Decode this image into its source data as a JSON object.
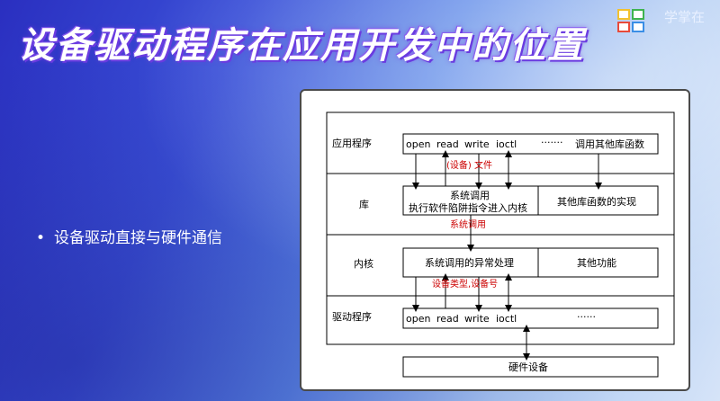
{
  "slide": {
    "title": "设备驱动程序在应用开发中的位置",
    "logo_text": "学掌在",
    "bullet": "设备驱动直接与硬件通信"
  },
  "diagram": {
    "layers": {
      "app": "应用程序",
      "lib": "库",
      "kernel": "内核",
      "driver": "驱动程序"
    },
    "app_row": {
      "calls": [
        "open",
        "read",
        "write",
        "ioctl",
        "·······"
      ],
      "other": "调用其他库函数"
    },
    "lib_row": {
      "syscall_line1": "系统调用",
      "syscall_line2": "执行软件陷阱指令进入内核",
      "other": "其他库函数的实现"
    },
    "kernel_row": {
      "exception": "系统调用的异常处理",
      "other": "其他功能"
    },
    "driver_row": {
      "calls": [
        "open",
        "read",
        "write",
        "ioctl",
        "······"
      ]
    },
    "hardware": "硬件设备",
    "annotations": {
      "device_file": "(设备) 文件",
      "syscall": "系统调用",
      "device_type": "设备类型,设备号"
    }
  }
}
